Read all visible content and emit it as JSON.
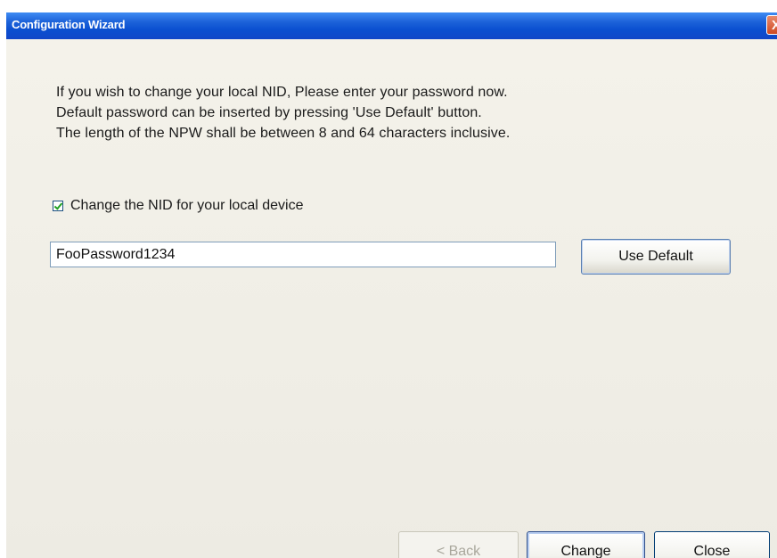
{
  "window": {
    "title": "Configuration Wizard",
    "close_glyph": "X"
  },
  "instructions": [
    "If you wish to change your local NID, Please enter your password now.",
    "Default password can be inserted by pressing 'Use Default' button.",
    "The length of the NPW shall be between 8 and 64 characters inclusive."
  ],
  "change_nid": {
    "label": "Change the NID for your local device",
    "checked": true
  },
  "password": {
    "value": "FooPassword1234"
  },
  "buttons": {
    "use_default": "Use Default",
    "back": "< Back",
    "change": "Change",
    "close": "Close"
  },
  "colors": {
    "titlebar": "#0a4fd0",
    "checkmark": "#21a121",
    "close_button": "#cf4a23"
  },
  "icons": {
    "close": "close-icon",
    "checkbox": "checkmark-icon"
  }
}
